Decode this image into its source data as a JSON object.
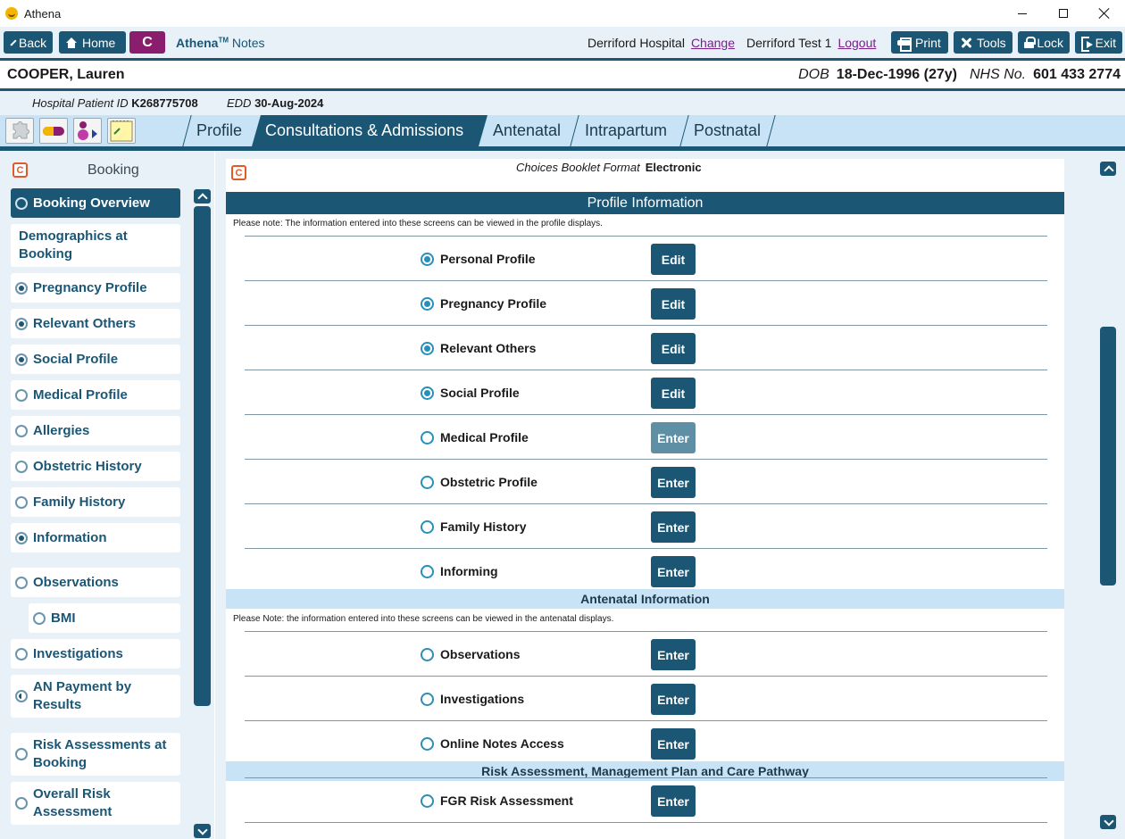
{
  "window": {
    "title": "Athena"
  },
  "toolbar": {
    "back": "Back",
    "home": "Home",
    "c_label": "C",
    "app_name": "Athena",
    "app_tm": "TM",
    "app_suffix": " Notes",
    "hospital": "Derriford Hospital",
    "change": "Change",
    "user": "Derriford Test 1",
    "logout": "Logout",
    "print": "Print",
    "tools": "Tools",
    "lock": "Lock",
    "exit": "Exit"
  },
  "patient": {
    "name": "COOPER, Lauren",
    "dob_label": "DOB",
    "dob": "18-Dec-1996 (27y)",
    "nhs_label": "NHS No.",
    "nhs": "601 433 2774",
    "hpid_label": "Hospital Patient ID",
    "hpid": "K268775708",
    "edd_label": "EDD",
    "edd": "30-Aug-2024"
  },
  "tabs": [
    "Profile",
    "Consultations & Admissions",
    "Antenatal",
    "Intrapartum",
    "Postnatal"
  ],
  "sidebar": {
    "c_icon": "C",
    "title": "Booking",
    "items": [
      {
        "label": "Booking Overview",
        "state": "active"
      },
      {
        "label": "Demographics at Booking",
        "state": "none"
      },
      {
        "label": "Pregnancy Profile",
        "state": "full"
      },
      {
        "label": "Relevant Others",
        "state": "full"
      },
      {
        "label": "Social Profile",
        "state": "full"
      },
      {
        "label": "Medical Profile",
        "state": "empty"
      },
      {
        "label": "Allergies",
        "state": "empty"
      },
      {
        "label": "Obstetric History",
        "state": "empty"
      },
      {
        "label": "Family History",
        "state": "empty"
      },
      {
        "label": "Information",
        "state": "full"
      },
      {
        "label": "Observations",
        "state": "empty"
      },
      {
        "label": "BMI",
        "state": "empty"
      },
      {
        "label": "Investigations",
        "state": "empty"
      },
      {
        "label": "AN Payment by Results",
        "state": "half"
      },
      {
        "label": "Risk Assessments at Booking",
        "state": "empty"
      },
      {
        "label": "Overall Risk Assessment",
        "state": "empty"
      }
    ]
  },
  "main": {
    "c_icon": "C",
    "choices_label": "Choices Booklet Format",
    "choices_value": "Electronic",
    "profile_header": "Profile Information",
    "profile_note": "Please note: The information entered into these screens can be viewed in the profile displays.",
    "profile_rows": [
      {
        "label": "Personal Profile",
        "button": "Edit",
        "checked": true
      },
      {
        "label": "Pregnancy Profile",
        "button": "Edit",
        "checked": true
      },
      {
        "label": "Relevant Others",
        "button": "Edit",
        "checked": true
      },
      {
        "label": "Social Profile",
        "button": "Edit",
        "checked": true
      },
      {
        "label": "Medical Profile",
        "button": "Enter",
        "checked": false
      },
      {
        "label": "Obstetric Profile",
        "button": "Enter",
        "checked": false
      },
      {
        "label": "Family History",
        "button": "Enter",
        "checked": false
      },
      {
        "label": "Informing",
        "button": "Enter",
        "checked": false
      }
    ],
    "antenatal_header": "Antenatal Information",
    "antenatal_note": "Please Note: the information entered into these screens can be viewed in the antenatal displays.",
    "antenatal_rows": [
      {
        "label": "Observations",
        "button": "Enter",
        "checked": false
      },
      {
        "label": "Investigations",
        "button": "Enter",
        "checked": false
      },
      {
        "label": "Online Notes Access",
        "button": "Enter",
        "checked": false
      }
    ],
    "risk_header": "Risk Assessment, Management Plan and Care Pathway",
    "risk_rows": [
      {
        "label": "FGR Risk Assessment",
        "button": "Enter",
        "checked": false
      }
    ]
  }
}
